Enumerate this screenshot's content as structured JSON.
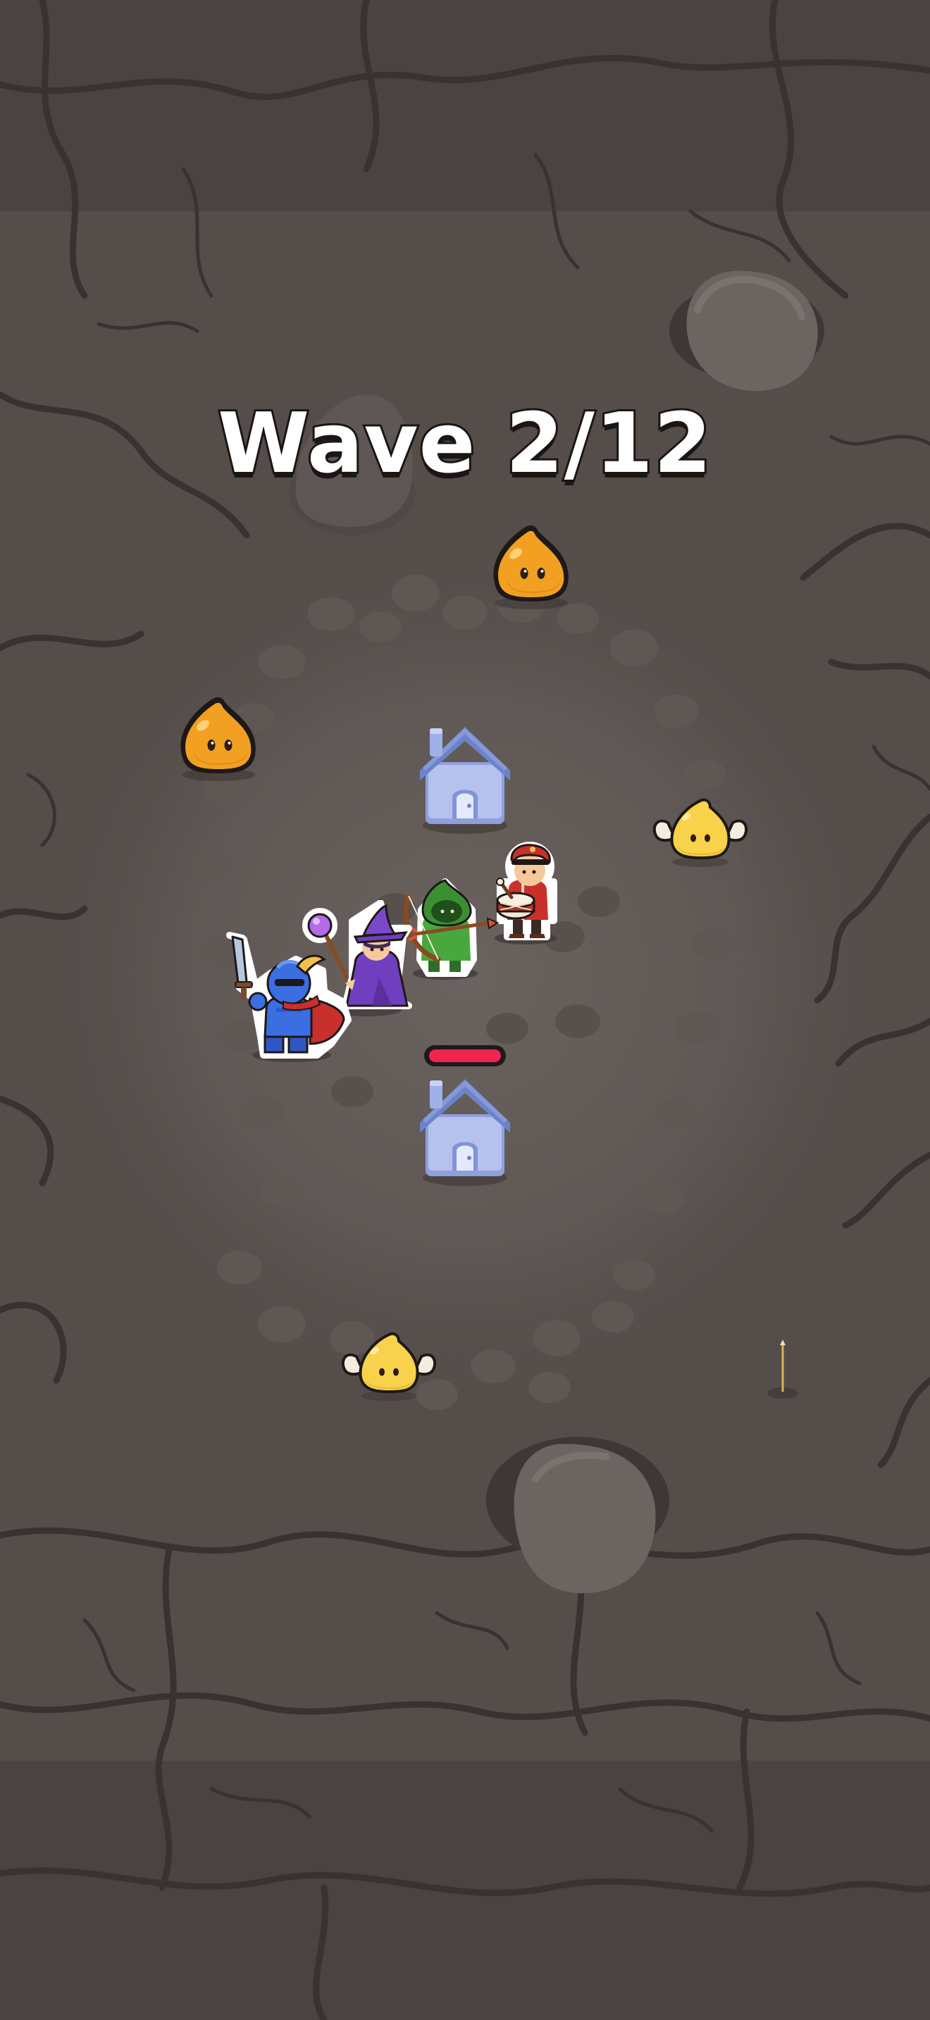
{
  "hud": {
    "wave_label": "Wave 2/12",
    "current_wave": 2,
    "total_waves": 12
  },
  "base": {
    "health_fraction": 1.0,
    "health_color": "#ee2453"
  },
  "colors": {
    "ground": "#554d4a",
    "ground_dark": "#3f3735",
    "crack": "#2e2826",
    "house_roof": "#6d83c9",
    "house_wall": "#a8b6e6",
    "slime_orange": "#f2a021",
    "slime_yellow": "#f7d24a"
  },
  "entities": {
    "heroes": [
      "knight",
      "wizard",
      "archer",
      "drummer"
    ],
    "structures": [
      "house",
      "house"
    ],
    "enemies": [
      "orange-slime",
      "orange-slime",
      "winged-yellow-slime",
      "winged-yellow-slime"
    ]
  }
}
